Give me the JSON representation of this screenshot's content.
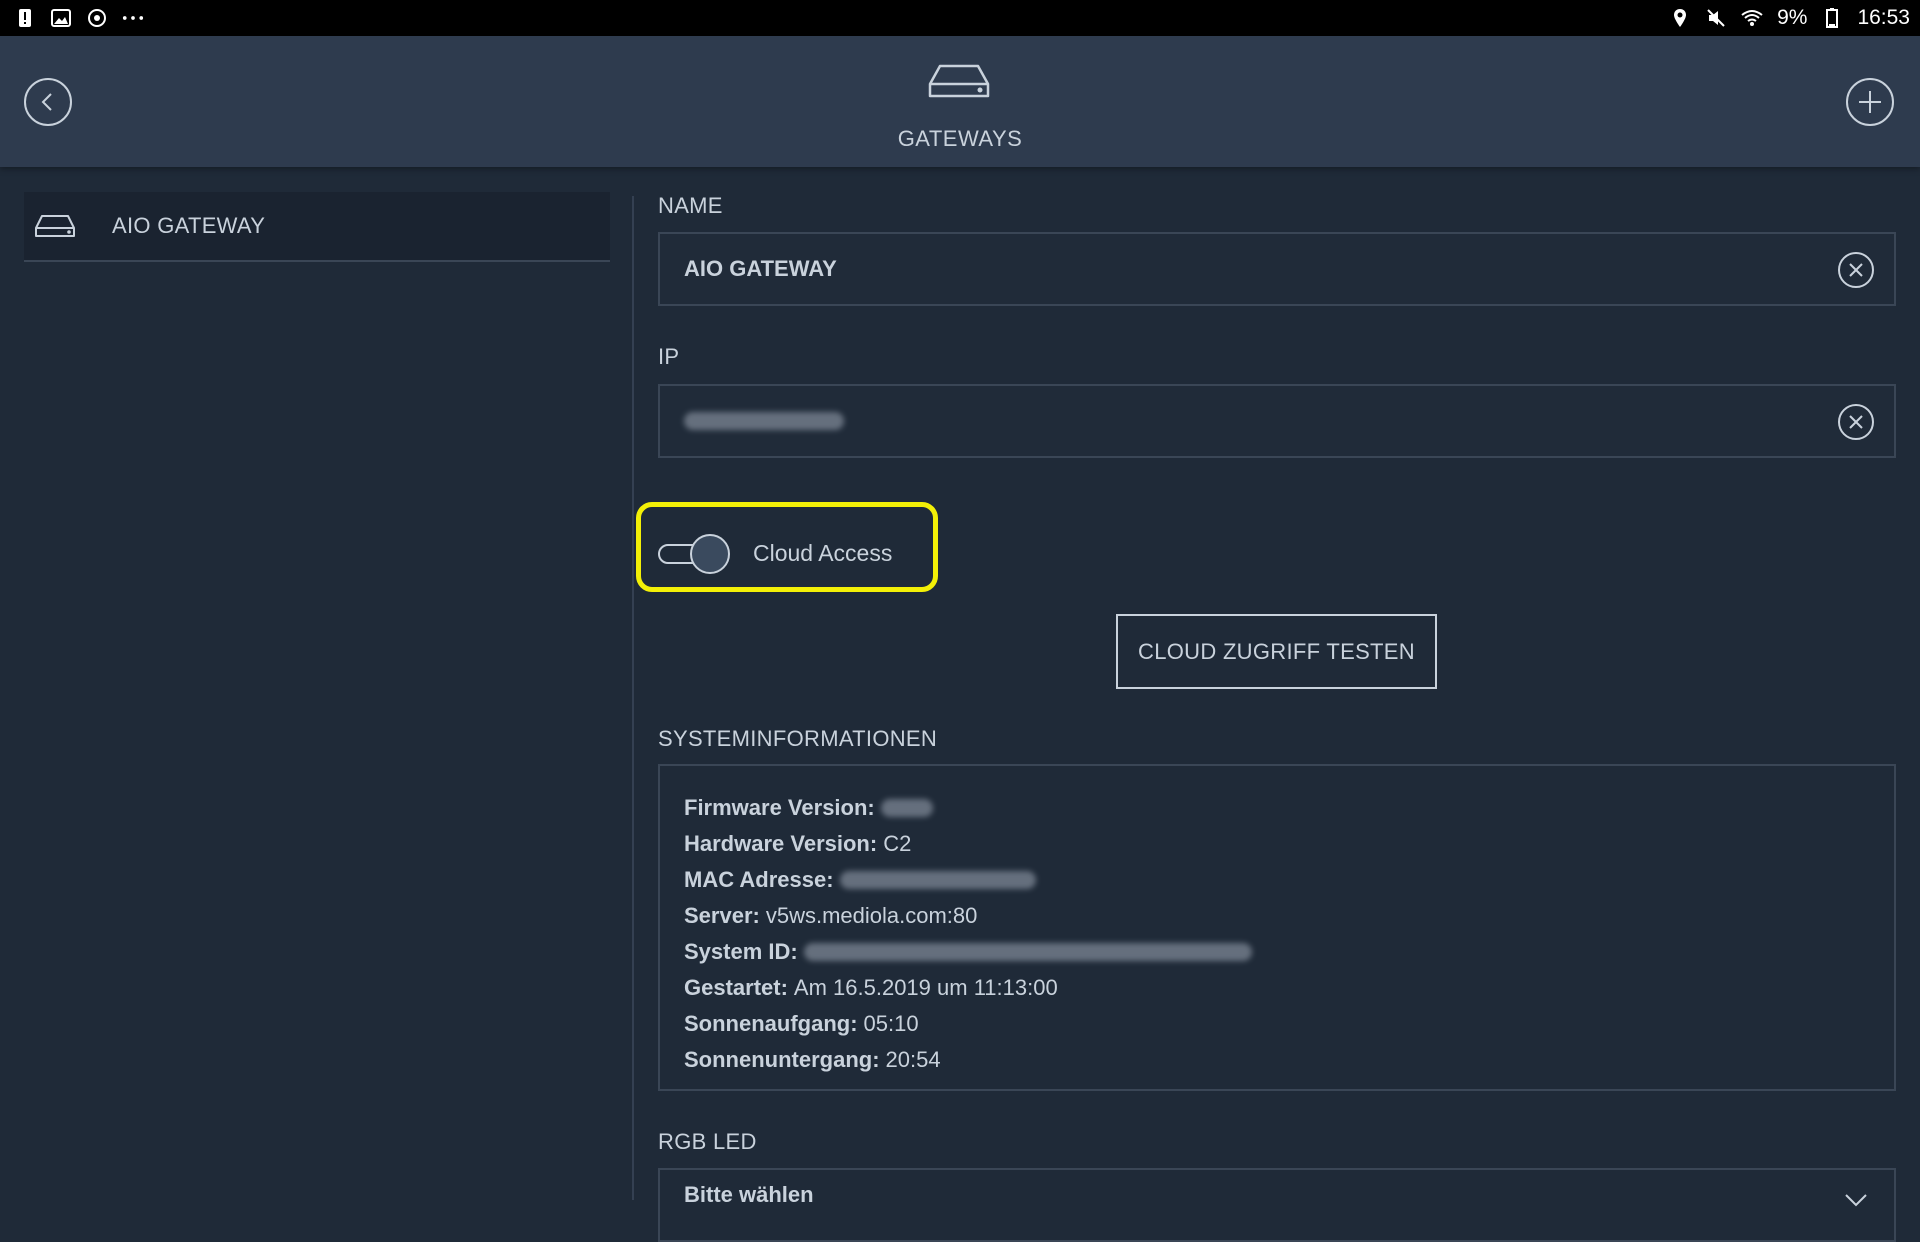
{
  "status_bar": {
    "left_icons": [
      "warning-icon",
      "gallery-icon",
      "sync-icon",
      "more-icon"
    ],
    "right_icons": [
      "location-icon",
      "mute-icon",
      "wifi-icon",
      "battery-icon"
    ],
    "battery": "9%",
    "time": "16:53"
  },
  "header": {
    "title": "GATEWAYS",
    "icon": "gateway-icon",
    "back_icon": "back-icon",
    "add_icon": "plus-icon"
  },
  "sidebar": {
    "items": [
      {
        "label": "AIO GATEWAY",
        "icon": "gateway-icon"
      }
    ]
  },
  "form": {
    "name_label": "NAME",
    "name_value": "AIO GATEWAY",
    "ip_label": "IP",
    "cloud_access_label": "Cloud Access",
    "cloud_access_on": true,
    "test_button": "CLOUD ZUGRIFF TESTEN"
  },
  "system_info": {
    "title": "SYSTEMINFORMATIONEN",
    "rows": [
      {
        "key": "Firmware Version:",
        "value": ""
      },
      {
        "key": "Hardware Version:",
        "value": "C2"
      },
      {
        "key": "MAC Adresse:",
        "value": ""
      },
      {
        "key": "Server:",
        "value": "v5ws.mediola.com:80"
      },
      {
        "key": "System ID:",
        "value": ""
      },
      {
        "key": "Gestartet:",
        "value": "Am 16.5.2019 um 11:13:00"
      },
      {
        "key": "Sonnenaufgang:",
        "value": "05:10"
      },
      {
        "key": "Sonnenuntergang:",
        "value": "20:54"
      }
    ]
  },
  "rgb_led": {
    "label": "RGB LED",
    "select_value": "Bitte wählen"
  },
  "colors": {
    "background": "#1f2a38",
    "header": "#2e3b4e",
    "text": "#c9d2dc",
    "highlight": "#f3f007"
  }
}
